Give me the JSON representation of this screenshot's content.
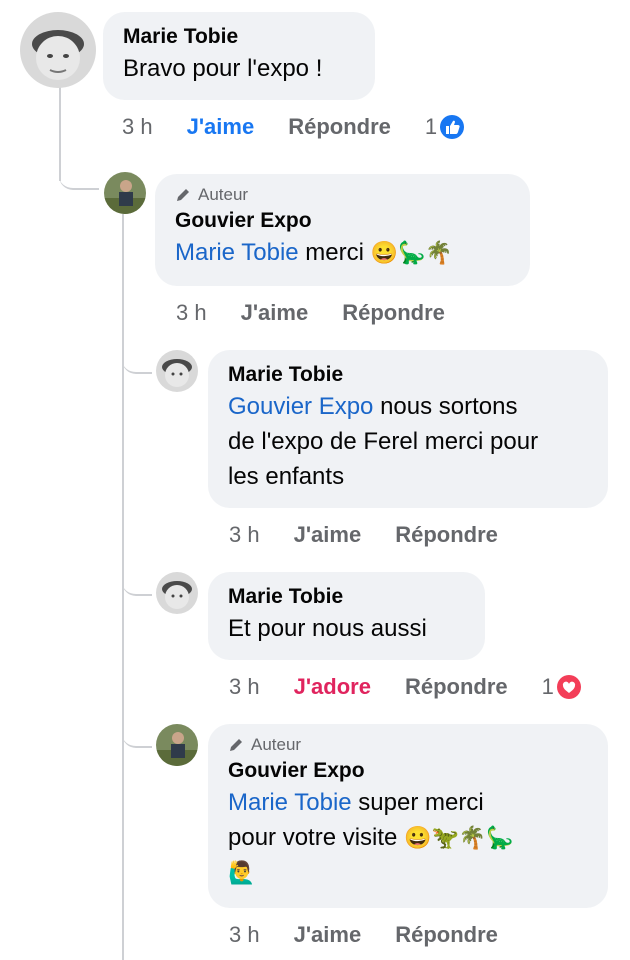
{
  "comments": [
    {
      "author": "Marie Tobie",
      "text": "Bravo pour l'expo !",
      "time": "3 h",
      "like_label": "J'aime",
      "reply_label": "Répondre",
      "reaction_count": "1"
    },
    {
      "author_badge": "Auteur",
      "author": "Gouvier Expo",
      "mention": "Marie Tobie",
      "text": " merci ",
      "emojis": "😀🦕🌴",
      "time": "3 h",
      "like_label": "J'aime",
      "reply_label": "Répondre"
    },
    {
      "author": "Marie Tobie",
      "mention": "Gouvier Expo",
      "text_line1": " nous sortons",
      "text_line2": "de l'expo de Ferel merci pour",
      "text_line3": "les enfants",
      "time": "3 h",
      "like_label": "J'aime",
      "reply_label": "Répondre"
    },
    {
      "author": "Marie Tobie",
      "text": "Et pour nous aussi",
      "time": "3 h",
      "like_label": "J'adore",
      "reply_label": "Répondre",
      "reaction_count": "1"
    },
    {
      "author_badge": "Auteur",
      "author": "Gouvier Expo",
      "mention": "Marie Tobie",
      "text_line1": " super merci",
      "text_line2": "pour votre visite ",
      "emojis_line2": "😀🦖🌴🦕",
      "emojis_line3": "🙋‍♂️",
      "time": "3 h",
      "like_label": "J'aime",
      "reply_label": "Répondre"
    }
  ],
  "colors": {
    "bubble": "#f0f2f5",
    "mention": "#1a66c9",
    "like_active": "#1877f2",
    "love_active": "#e0245e",
    "meta": "#65676b"
  }
}
